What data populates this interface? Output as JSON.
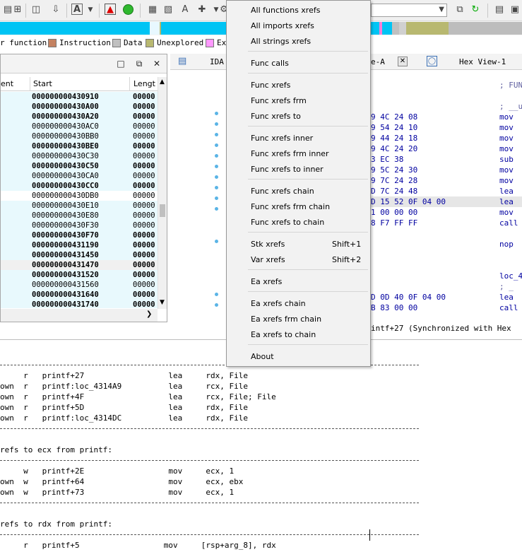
{
  "toolbar": {
    "icons": [
      "nav-icon",
      "jump-icon",
      "save-icon",
      "down-arrow-icon",
      "text-icon",
      "dropdown-icon",
      "breakpoint-icon",
      "run-icon",
      "struct-icon",
      "enum-icon",
      "text-A-icon",
      "add-icon",
      "gear-icon"
    ],
    "segment_select": ""
  },
  "legend": {
    "items": [
      {
        "label": "r function",
        "color": "#00ccff"
      },
      {
        "label": "Instruction",
        "color": "#c48262"
      },
      {
        "label": "Data",
        "color": "#c0c0c0"
      },
      {
        "label": "Unexplored",
        "color": "#b8b870"
      },
      {
        "label": "Ex",
        "color": "#ff99ff"
      }
    ]
  },
  "functions_panel": {
    "columns": [
      "ent",
      "Start",
      "Lengt"
    ],
    "rows": [
      {
        "start": "000000000430910",
        "len": "00000",
        "bold": true
      },
      {
        "start": "000000000430A00",
        "len": "00000",
        "bold": true
      },
      {
        "start": "000000000430A20",
        "len": "00000",
        "bold": true
      },
      {
        "start": "000000000430AC0",
        "len": "00000",
        "bold": false
      },
      {
        "start": "000000000430BB0",
        "len": "00000",
        "bold": false
      },
      {
        "start": "000000000430BE0",
        "len": "00000",
        "bold": true
      },
      {
        "start": "000000000430C30",
        "len": "00000",
        "bold": false
      },
      {
        "start": "000000000430C50",
        "len": "00000",
        "bold": true
      },
      {
        "start": "000000000430CA0",
        "len": "00000",
        "bold": false
      },
      {
        "start": "000000000430CC0",
        "len": "00000",
        "bold": true
      },
      {
        "start": "000000000430DB0",
        "len": "00000",
        "bold": false
      },
      {
        "start": "000000000430E10",
        "len": "00000",
        "bold": false
      },
      {
        "start": "000000000430E80",
        "len": "00000",
        "bold": false
      },
      {
        "start": "000000000430F30",
        "len": "00000",
        "bold": false
      },
      {
        "start": "000000000430F70",
        "len": "00000",
        "bold": true
      },
      {
        "start": "000000000431190",
        "len": "00000",
        "bold": true
      },
      {
        "start": "000000000431450",
        "len": "00000",
        "bold": true
      },
      {
        "start": "000000000431470",
        "len": "00000",
        "bold": true
      },
      {
        "start": "000000000431520",
        "len": "00000",
        "bold": true
      },
      {
        "start": "000000000431560",
        "len": "00000",
        "bold": false
      },
      {
        "start": "000000000431640",
        "len": "00000",
        "bold": true
      },
      {
        "start": "000000000431740",
        "len": "00000",
        "bold": true
      }
    ]
  },
  "tabs": [
    {
      "label": "IDA"
    },
    {
      "label": "e-A"
    },
    {
      "label": "Hex View-1"
    }
  ],
  "hex_view": {
    "rows": [
      {
        "bytes": "",
        "op": "; FUN"
      },
      {
        "bytes": "",
        "op": ""
      },
      {
        "bytes": "",
        "op": "; __u"
      },
      {
        "bytes": "9 4C 24 08",
        "op": "mov"
      },
      {
        "bytes": "9 54 24 10",
        "op": "mov"
      },
      {
        "bytes": "9 44 24 18",
        "op": "mov"
      },
      {
        "bytes": "9 4C 24 20",
        "op": "mov"
      },
      {
        "bytes": "3 EC 38",
        "op": "sub"
      },
      {
        "bytes": "9 5C 24 30",
        "op": "mov"
      },
      {
        "bytes": "9 7C 24 28",
        "op": "mov"
      },
      {
        "bytes": "D 7C 24 48",
        "op": "lea"
      },
      {
        "bytes": "D 15 52 0F 04 00",
        "op": "lea"
      },
      {
        "bytes": "1 00 00 00",
        "op": "mov"
      },
      {
        "bytes": "8 F7 FF FF",
        "op": "call"
      },
      {
        "bytes": "",
        "op": ""
      },
      {
        "bytes": "",
        "op": "nop"
      },
      {
        "bytes": "",
        "op": ""
      },
      {
        "bytes": "",
        "op": ""
      },
      {
        "bytes": "",
        "op": "loc_4"
      },
      {
        "bytes": "",
        "op": ";  _"
      },
      {
        "bytes": "D 0D 40 0F 04 00",
        "op": "lea"
      },
      {
        "bytes": "B 83 00 00",
        "op": "call"
      }
    ],
    "sync_text": "intf+27 (Synchronized with Hex"
  },
  "xrefs": {
    "lines": [
      {
        "text": "     r   printf+27                  lea     rdx, File"
      },
      {
        "text": "own  r   printf:loc_4314A9          lea     rcx, File"
      },
      {
        "text": "own  r   printf+4F                  lea     rcx, File; File"
      },
      {
        "text": "own  r   printf+5D                  lea     rdx, File"
      },
      {
        "text": "own  r   printf:loc_4314DC          lea     rdx, File"
      },
      {
        "text": "refs to ecx from printf:"
      },
      {
        "text": "     w   printf+2E                  mov     ecx, 1"
      },
      {
        "text": "own  w   printf+64                  mov     ecx, ebx"
      },
      {
        "text": "own  w   printf+73                  mov     ecx, 1"
      },
      {
        "text": "refs to rdx from printf:"
      },
      {
        "text": "     r   printf+5                  mov     [rsp+arg_8], rdx"
      }
    ]
  },
  "menu": {
    "items": [
      {
        "label": "All functions xrefs",
        "shortcut": ""
      },
      {
        "label": "All imports xrefs",
        "shortcut": ""
      },
      {
        "label": "All strings xrefs",
        "shortcut": ""
      },
      {
        "label": "Func calls",
        "shortcut": ""
      },
      {
        "label": "Func xrefs",
        "shortcut": ""
      },
      {
        "label": "Func xrefs frm",
        "shortcut": ""
      },
      {
        "label": "Func xrefs to",
        "shortcut": ""
      },
      {
        "label": "Func xrefs inner",
        "shortcut": ""
      },
      {
        "label": "Func xrefs frm inner",
        "shortcut": ""
      },
      {
        "label": "Func xrefs to  inner",
        "shortcut": ""
      },
      {
        "label": "Func xrefs chain",
        "shortcut": ""
      },
      {
        "label": "Func xrefs frm chain",
        "shortcut": ""
      },
      {
        "label": "Func xrefs to  chain",
        "shortcut": ""
      },
      {
        "label": "Stk xrefs",
        "shortcut": "Shift+1"
      },
      {
        "label": "Var xrefs",
        "shortcut": "Shift+2"
      },
      {
        "label": "Ea xrefs",
        "shortcut": ""
      },
      {
        "label": "Ea xrefs chain",
        "shortcut": ""
      },
      {
        "label": "Ea xrefs frm chain",
        "shortcut": ""
      },
      {
        "label": "Ea xrefs to chain",
        "shortcut": ""
      },
      {
        "label": "About",
        "shortcut": ""
      }
    ]
  }
}
